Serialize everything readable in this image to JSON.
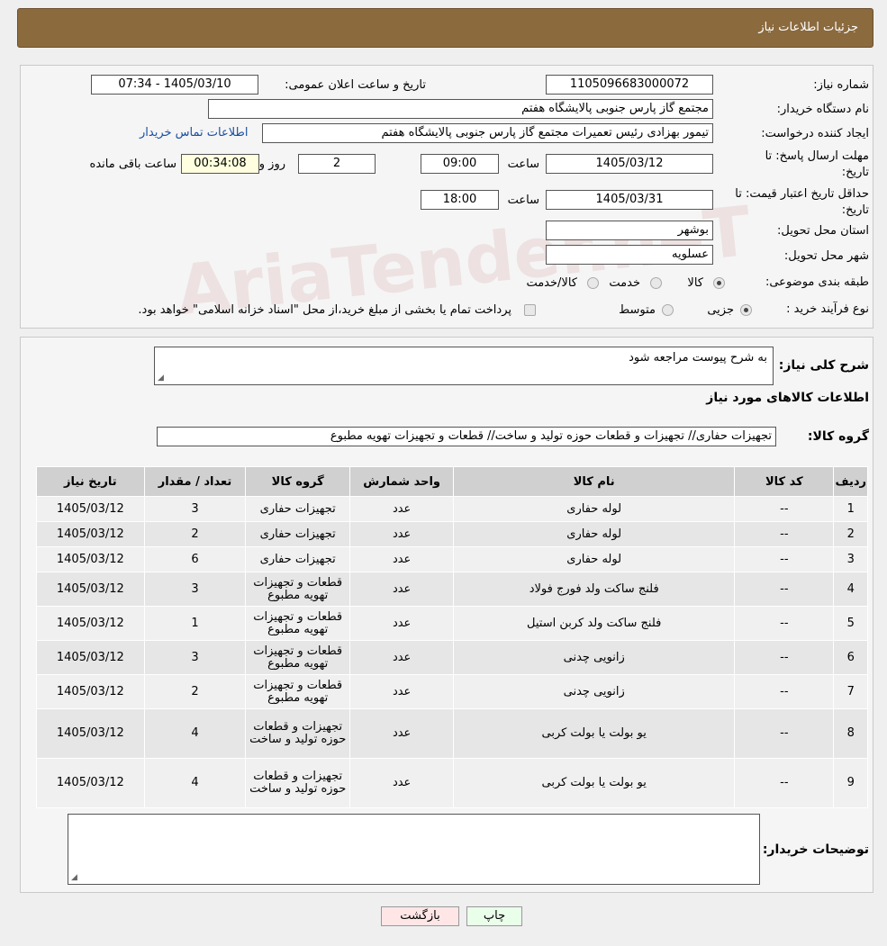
{
  "header": {
    "title": "جزئیات اطلاعات نیاز"
  },
  "watermark": "AriaTender.neT",
  "info": {
    "need_number_label": "شماره نیاز:",
    "need_number": "1105096683000072",
    "announce_label": "تاریخ و ساعت اعلان عمومی:",
    "announce_value": "1405/03/10 - 07:34",
    "buyer_label": "نام دستگاه خریدار:",
    "buyer_value": "مجتمع گاز پارس جنوبی  پالایشگاه هفتم",
    "creator_label": "ایجاد کننده درخواست:",
    "creator_value": "تیمور بهزادی رئیس تعمیرات مجتمع گاز پارس جنوبی  پالایشگاه هفتم",
    "contact_link": "اطلاعات تماس خریدار",
    "deadline_label_1": "مهلت ارسال پاسخ: تا",
    "deadline_label_2": "تاریخ:",
    "deadline_date": "1405/03/12",
    "time_label": "ساعت",
    "deadline_time": "09:00",
    "days_value": "2",
    "days_label": "روز و",
    "remaining_value": "00:34:08",
    "remaining_label": "ساعت باقی مانده",
    "validity_label_1": "حداقل تاریخ اعتبار قیمت: تا",
    "validity_label_2": "تاریخ:",
    "validity_date": "1405/03/31",
    "validity_time": "18:00",
    "province_label": "استان محل تحویل:",
    "province_value": "بوشهر",
    "city_label": "شهر محل تحویل:",
    "city_value": "عسلویه",
    "category_label": "طبقه بندی موضوعی:",
    "category_options": [
      "کالا",
      "خدمت",
      "کالا/خدمت"
    ],
    "purchase_label": "نوع فرآیند خرید :",
    "purchase_options": [
      "جزیی",
      "متوسط"
    ],
    "purchase_note": "پرداخت تمام یا بخشی از مبلغ خرید،از محل \"اسناد خزانه اسلامی\" خواهد بود."
  },
  "description": {
    "label": "شرح کلی نیاز:",
    "value": "به شرح پیوست مراجعه شود"
  },
  "goods": {
    "section_title": "اطلاعات کالاهای مورد نیاز",
    "group_label": "گروه کالا:",
    "group_value": "تجهیزات حفاری// تجهیزات و قطعات حوزه تولید و ساخت//  قطعات و تجهیزات تهویه مطبوع",
    "columns": [
      "ردیف",
      "کد کالا",
      "نام کالا",
      "واحد شمارش",
      "گروه کالا",
      "تعداد / مقدار",
      "تاریخ نیاز"
    ],
    "rows": [
      [
        "1",
        "--",
        "لوله حفاری",
        "عدد",
        "تجهیزات حفاری",
        "3",
        "1405/03/12"
      ],
      [
        "2",
        "--",
        "لوله حفاری",
        "عدد",
        "تجهیزات حفاری",
        "2",
        "1405/03/12"
      ],
      [
        "3",
        "--",
        "لوله حفاری",
        "عدد",
        "تجهیزات حفاری",
        "6",
        "1405/03/12"
      ],
      [
        "4",
        "--",
        "فلنج ساکت ولد فورج فولاد",
        "عدد",
        "قطعات و تجهیزات تهویه مطبوع",
        "3",
        "1405/03/12"
      ],
      [
        "5",
        "--",
        "فلنج ساکت ولد کربن استیل",
        "عدد",
        "قطعات و تجهیزات تهویه مطبوع",
        "1",
        "1405/03/12"
      ],
      [
        "6",
        "--",
        "زانویی چدنی",
        "عدد",
        "قطعات و تجهیزات تهویه مطبوع",
        "3",
        "1405/03/12"
      ],
      [
        "7",
        "--",
        "زانویی چدنی",
        "عدد",
        "قطعات و تجهیزات تهویه مطبوع",
        "2",
        "1405/03/12"
      ],
      [
        "8",
        "--",
        "یو بولت یا بولت کربی",
        "عدد",
        "تجهیزات و قطعات حوزه تولید و ساخت",
        "4",
        "1405/03/12"
      ],
      [
        "9",
        "--",
        "یو بولت یا بولت کربی",
        "عدد",
        "تجهیزات و قطعات حوزه تولید و ساخت",
        "4",
        "1405/03/12"
      ]
    ]
  },
  "buyer_notes": {
    "label": "توضیحات خریدار:",
    "value": ""
  },
  "buttons": {
    "print": "چاپ",
    "back": "بازگشت"
  }
}
